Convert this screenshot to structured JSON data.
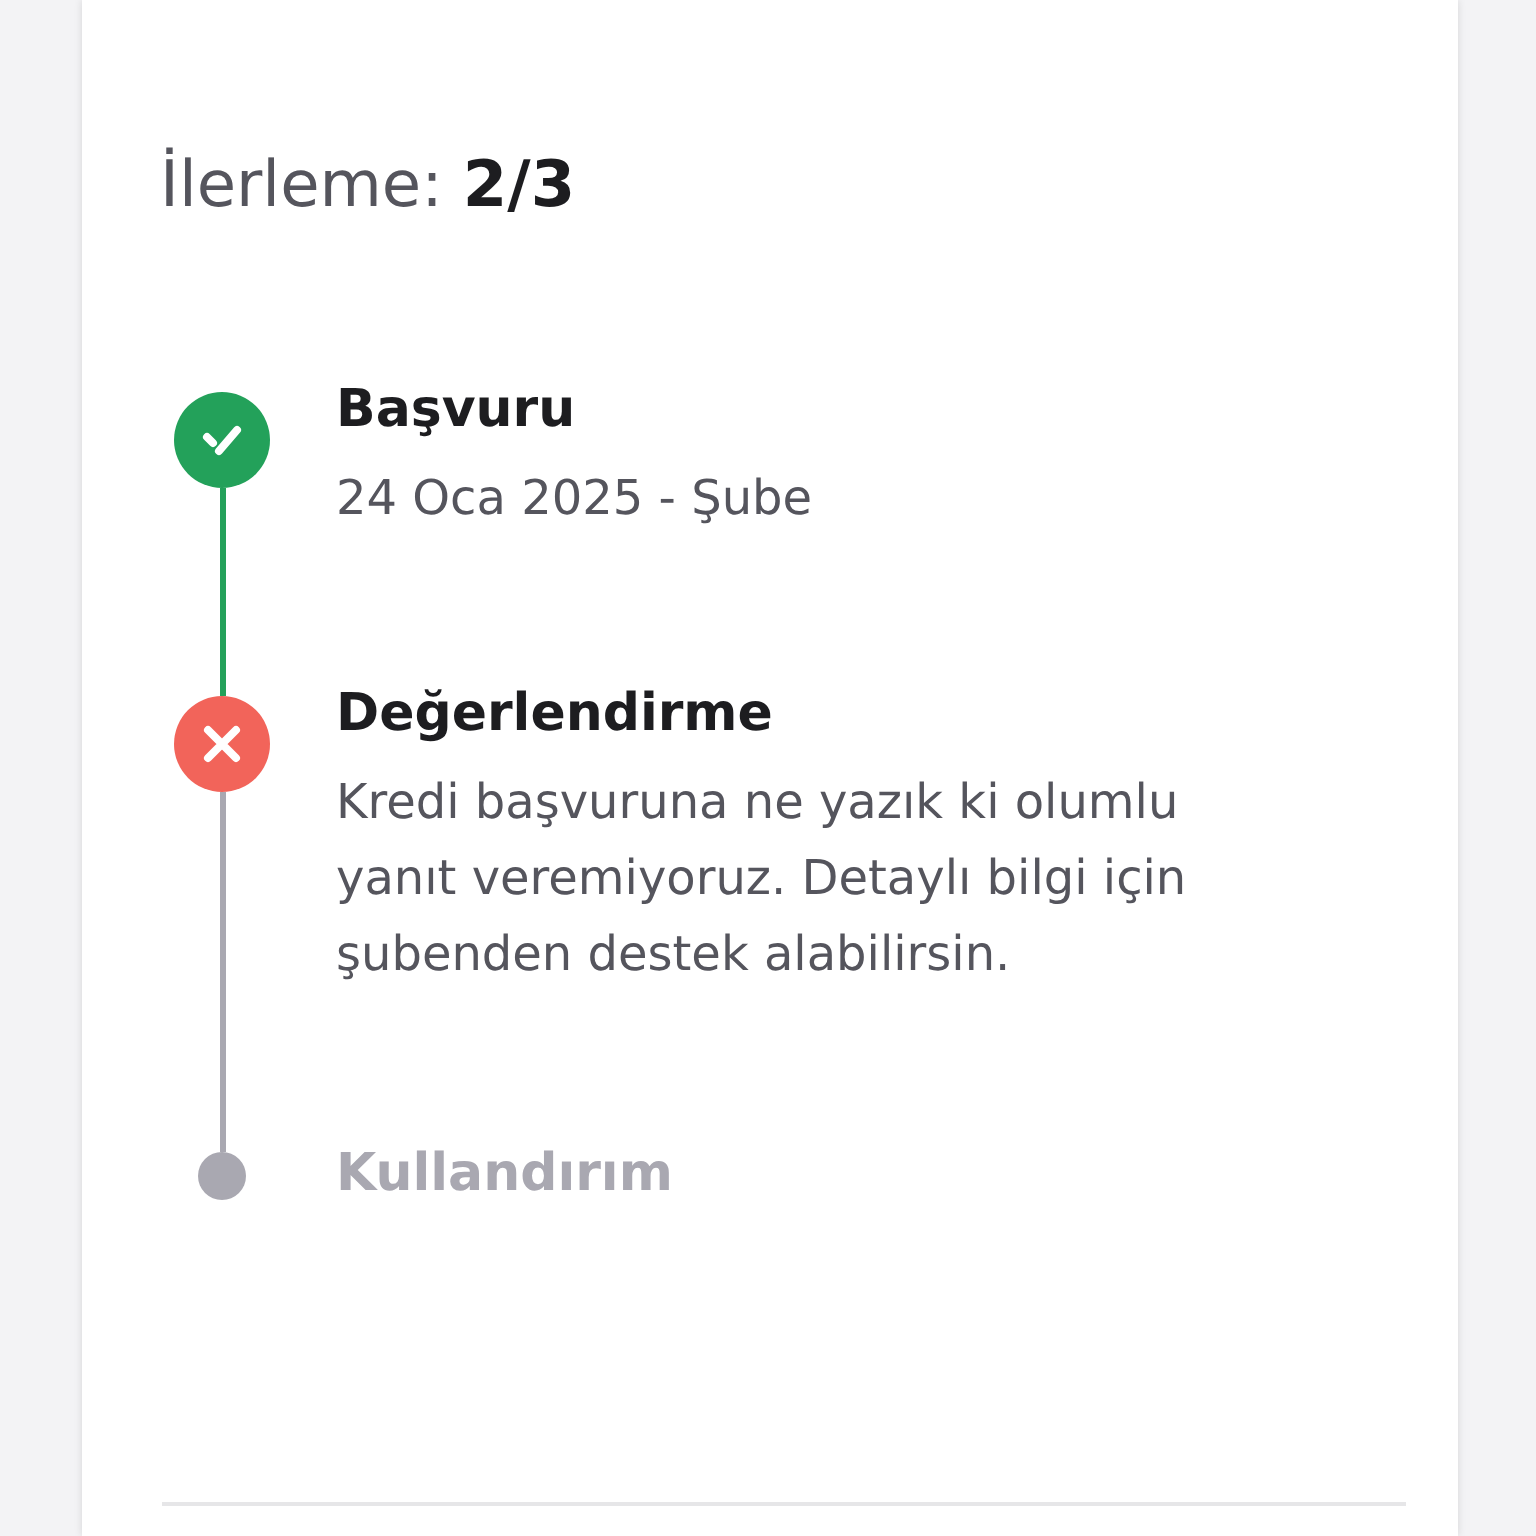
{
  "progress": {
    "label": "İlerleme:",
    "value": "2/3"
  },
  "steps": [
    {
      "title": "Başvuru",
      "kind": "done",
      "detail": "24 Oca 2025 - Şube"
    },
    {
      "title": "Değerlendirme",
      "kind": "failed",
      "detail": "Kredi başvuruna ne yazık ki olumlu yanıt veremiyoruz. Detaylı bilgi için şubenden destek alabilirsin."
    },
    {
      "title": "Kullandırım",
      "kind": "pending"
    }
  ]
}
